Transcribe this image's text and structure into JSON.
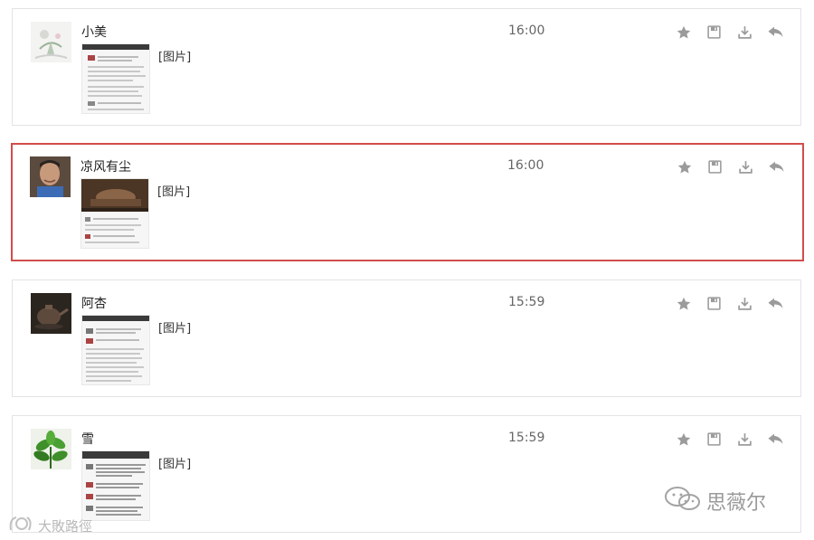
{
  "messages": [
    {
      "sender": "小美",
      "time": "16:00",
      "content_label": "[图片]",
      "highlighted": false,
      "avatar_icon": "flower-painting-avatar",
      "thumb_icon": "chat-screenshot-thumbnail"
    },
    {
      "sender": "凉风有尘",
      "time": "16:00",
      "content_label": "[图片]",
      "highlighted": true,
      "avatar_icon": "person-photo-avatar",
      "thumb_icon": "tea-photo-chat-screenshot-thumbnail"
    },
    {
      "sender": "阿杏",
      "time": "15:59",
      "content_label": "[图片]",
      "highlighted": false,
      "avatar_icon": "teapot-avatar",
      "thumb_icon": "chat-screenshot-thumbnail"
    },
    {
      "sender": "雪",
      "time": "15:59",
      "content_label": "[图片]",
      "highlighted": false,
      "avatar_icon": "green-plant-avatar",
      "thumb_icon": "chat-screenshot-thumbnail"
    }
  ],
  "actions": [
    "star-icon",
    "save-icon",
    "download-icon",
    "reply-icon"
  ],
  "colors": {
    "highlight_border": "#d24d4d",
    "card_border": "#e3e3e3",
    "icon": "#9b9b9b"
  },
  "watermark_right": {
    "text": "思薇尔",
    "icon": "wechat-icon"
  },
  "watermark_left": {
    "text": "大敗路徑",
    "icon": "logo-icon"
  }
}
